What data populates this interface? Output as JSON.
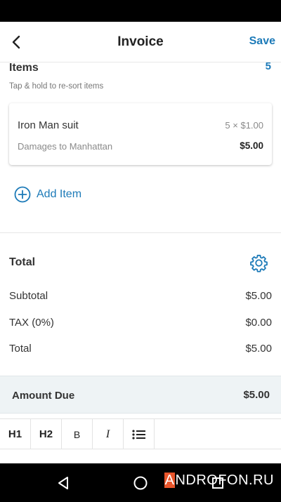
{
  "app_bar": {
    "title": "Invoice",
    "save_label": "Save"
  },
  "items_section": {
    "heading": "Items",
    "count": "5",
    "hint": "Tap & hold to re-sort items",
    "items": [
      {
        "name": "Iron Man suit",
        "quantity_price": "5 × $1.00",
        "description": "Damages to Manhattan",
        "amount": "$5.00"
      }
    ],
    "add_item_label": "Add Item"
  },
  "total_section": {
    "heading": "Total",
    "rows": [
      {
        "label": "Subtotal",
        "value": "$5.00"
      },
      {
        "label": "TAX (0%)",
        "value": "$0.00"
      },
      {
        "label": "Total",
        "value": "$5.00"
      }
    ]
  },
  "amount_due": {
    "label": "Amount Due",
    "value": "$5.00"
  },
  "format_toolbar": {
    "h1": "H1",
    "h2": "H2",
    "bold": "B",
    "italic": "I",
    "list_icon": "bullet-list-icon"
  },
  "watermark": {
    "first_letter": "A",
    "rest": "NDROFON.RU"
  },
  "colors": {
    "accent": "#1c7ab8",
    "amount_due_bg": "#eef3f5",
    "watermark_accent": "#e8552b"
  }
}
